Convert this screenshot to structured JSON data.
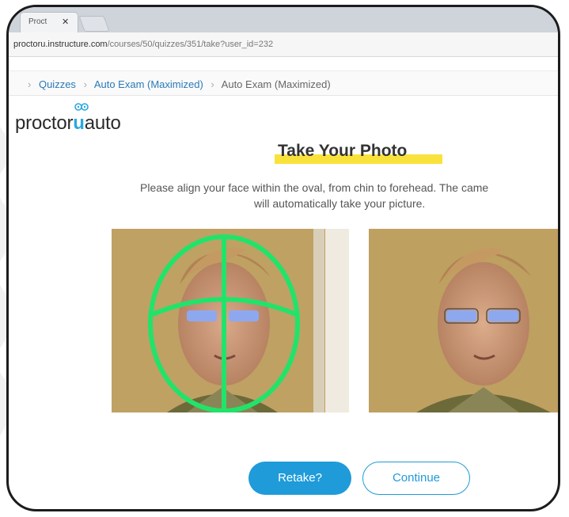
{
  "browser": {
    "tab_title": "Proct",
    "tab_close_icon": "close-icon",
    "url_host": "proctoru.instructure.com",
    "url_path": "/courses/50/quizzes/351/take?user_id=232"
  },
  "breadcrumb": {
    "items": [
      "Quizzes",
      "Auto Exam (Maximized)"
    ],
    "current": "Auto Exam (Maximized)"
  },
  "logo": {
    "part1": "proctor",
    "part2": "u",
    "part3": "auto"
  },
  "page": {
    "title": "Take Your Photo",
    "instruction_line1": "Please align your face within the oval, from chin to forehead.  The came",
    "instruction_line2": "will automatically take your picture."
  },
  "photos": {
    "live_alt": "Live camera feed with face alignment oval",
    "captured_alt": "Captured photo"
  },
  "buttons": {
    "retake": "Retake?",
    "continue": "Continue"
  },
  "colors": {
    "accent": "#1f9bd9",
    "highlight": "#f9e23c",
    "oval": "#22e36a"
  }
}
